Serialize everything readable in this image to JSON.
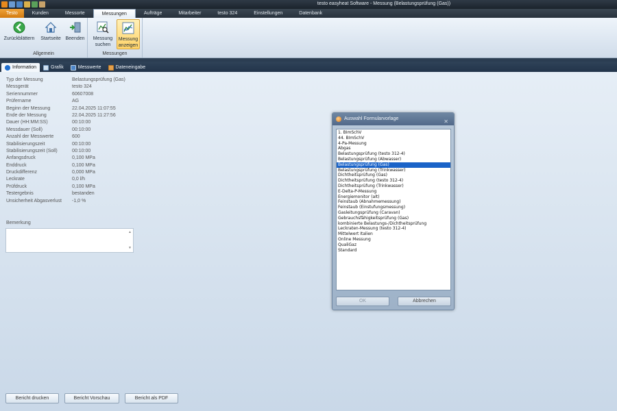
{
  "window": {
    "title": "testo easyheat Software - Messung (Belastungsprüfung (Gas))"
  },
  "menu": {
    "tabs": [
      "Testo",
      "Kunden",
      "Messorte",
      "Messungen",
      "Aufträge",
      "Mitarbeiter",
      "testo 324",
      "Einstellungen",
      "Datenbank"
    ],
    "active": "Messungen"
  },
  "ribbon": {
    "group_allgemein": {
      "label": "Allgemein",
      "back": "Zurückblättern",
      "home": "Startseite",
      "exit": "Beenden"
    },
    "group_messungen": {
      "label": "Messungen",
      "search_l1": "Messung",
      "search_l2": "suchen",
      "show_l1": "Messung",
      "show_l2": "anzeigen"
    }
  },
  "tabs": [
    {
      "label": "Information",
      "icon": "info-icon"
    },
    {
      "label": "Grafik",
      "icon": "chart-icon"
    },
    {
      "label": "Messwerte",
      "icon": "table-icon"
    },
    {
      "label": "Dateneingabe",
      "icon": "form-icon"
    }
  ],
  "info": [
    {
      "label": "Typ der Messung",
      "value": "Belastungsprüfung (Gas)"
    },
    {
      "label": "Messgerät",
      "value": "testo 324"
    },
    {
      "label": "Seriennummer",
      "value": "60607008"
    },
    {
      "label": "Prüfername",
      "value": "AG"
    },
    {
      "label": "Beginn der Messung",
      "value": "22.04.2025 11:07:55"
    },
    {
      "label": "Ende der Messung",
      "value": "22.04.2025 11:27:56"
    },
    {
      "label": "Dauer (HH:MM:SS)",
      "value": "00:10:00"
    },
    {
      "label": "Messdauer (Soll)",
      "value": "00:10:00"
    },
    {
      "label": "Anzahl der Messwerte",
      "value": "600"
    },
    {
      "label": "Stabilisierungszeit",
      "value": "00:10:00"
    },
    {
      "label": "Stabilisierungszeit (Soll)",
      "value": "00:10:00"
    },
    {
      "label": "Anfangsdruck",
      "value": "0,100 MPa"
    },
    {
      "label": "Enddruck",
      "value": "0,100 MPa"
    },
    {
      "label": "Druckdifferenz",
      "value": "0,000 MPa"
    },
    {
      "label": "Leckrate",
      "value": "0,0 l/h"
    },
    {
      "label": "Prüfdruck",
      "value": "0,100 MPa"
    },
    {
      "label": "Testergebnis",
      "value": "bestanden"
    },
    {
      "label": "Unsicherheit Abgasverlust",
      "value": "-1,0 %"
    }
  ],
  "remark": {
    "label": "Bemerkung",
    "value": ""
  },
  "bottom_buttons": {
    "print": "Bericht drucken",
    "preview": "Bericht Vorschau",
    "pdf": "Bericht als PDF"
  },
  "dialog": {
    "title": "Auswahl Formularvorlage",
    "close": "✕",
    "selected": "Belastungsprüfung (Gas)",
    "items": [
      "1. BImSchV",
      "44. BImSchV",
      "4-Pa-Messung",
      "Abgas",
      "Belastungsprüfung  (testo 312-4)",
      "Belastungsprüfung (Abwasser)",
      "Belastungsprüfung (Gas)",
      "Belastungsprüfung (Trinkwasser)",
      "Dichtheitsprüfung (Gas)",
      "Dichtheitsprüfung (testo 312-4)",
      "Dichtheitsprüfung (Trinkwasser)",
      "E-Delta-P-Messung",
      "Energiemonitor (alt)",
      "Feinstaub (Abnahmemessung)",
      "Feinstaub (Einstufungsmessung)",
      "Gasleitungsprüfung (Caravan)",
      "Gebrauchsfähigkeitsprüfung (Gas)",
      "kombinierte Belastungs-/Dichtheitsprüfung",
      "Leckraten-Messung  (testo 312-4)",
      "Mittelwert Italien",
      "Online Messung",
      "QualiGaz",
      "Standard"
    ],
    "ok": "OK",
    "cancel": "Abbrechen"
  }
}
